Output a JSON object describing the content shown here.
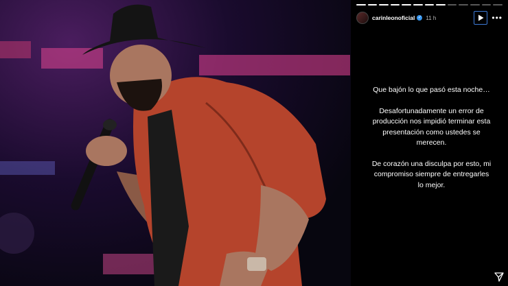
{
  "story": {
    "username": "carinleonoficial",
    "verified_icon": "verified-badge-icon",
    "time": "11 h",
    "progress_segments_total": 13,
    "progress_segments_done": 8,
    "message_lines": [
      "Que bajón lo que pasó esta noche…",
      "Desafortunadamente un error de",
      "producción nos impidió terminar esta",
      "presentación como ustedes se",
      "merecen.",
      "De corazón una disculpa por esto, mi",
      "compromiso siempre de entregarles",
      "lo mejor."
    ]
  },
  "icons": {
    "play": "play-icon",
    "more": "more-options-icon",
    "send": "send-icon"
  },
  "colors": {
    "accent": "#3d7bd9",
    "verified": "#3897f0",
    "jacket": "#b5442c"
  }
}
